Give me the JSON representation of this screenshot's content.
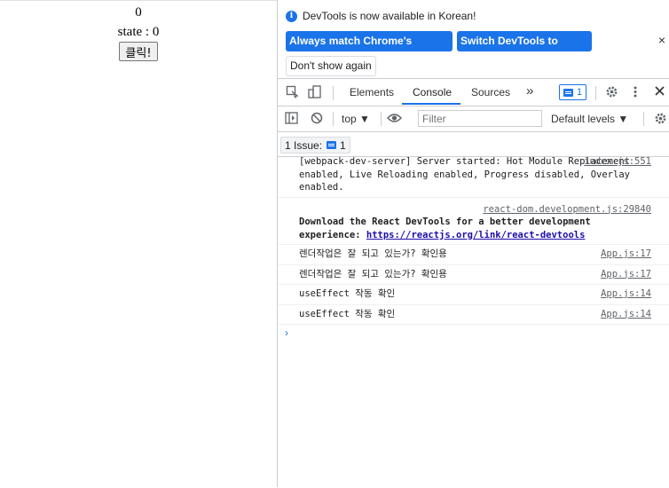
{
  "page": {
    "counter": "0",
    "state_text": "state : 0",
    "button_label": "클릭!"
  },
  "devtools": {
    "infobar": {
      "message": "DevTools is now available in Korean!",
      "btn_match": "Always match Chrome's language",
      "btn_switch": "Switch DevTools to Korean",
      "btn_dont_show": "Don't show again",
      "close": "×"
    },
    "tabs": {
      "elements": "Elements",
      "console": "Console",
      "sources": "Sources",
      "more": "»",
      "issues_count": "1"
    },
    "toolbar": {
      "context": "top ▼",
      "filter_placeholder": "Filter",
      "levels": "Default levels ▼"
    },
    "issues": {
      "label": "1 Issue:",
      "count": "1"
    },
    "messages": [
      {
        "text": "[webpack-dev-server] Server started: Hot Module Replacement enabled, Live Reloading enabled, Progress disabled, Overlay enabled.",
        "source": "index.js:551"
      },
      {
        "source": "react-dom.development.js:29840",
        "text": "Download the React DevTools for a better development experience:",
        "link": "https://reactjs.org/link/react-devtools"
      },
      {
        "text": "렌더작업은 잘 되고 있는가? 확인용",
        "source": "App.js:17"
      },
      {
        "text": "렌더작업은 잘 되고 있는가? 확인용",
        "source": "App.js:17"
      },
      {
        "text": "useEffect 작동 확인",
        "source": "App.js:14"
      },
      {
        "text": "useEffect 작동 확인",
        "source": "App.js:14"
      }
    ],
    "prompt": "›"
  },
  "colors": {
    "accent": "#1a73e8",
    "border": "#cbcdd1"
  }
}
